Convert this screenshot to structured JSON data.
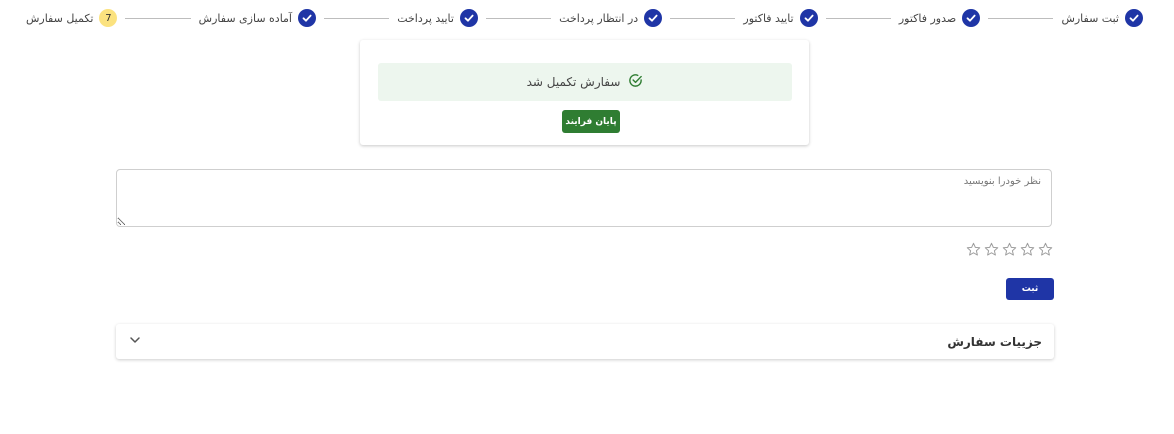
{
  "stepper": {
    "steps": [
      {
        "label": "ثبت سفارش",
        "status": "done",
        "icon": "check-icon"
      },
      {
        "label": "صدور فاکتور",
        "status": "done",
        "icon": "check-icon"
      },
      {
        "label": "تایید فاکتور",
        "status": "done",
        "icon": "check-icon"
      },
      {
        "label": "در انتظار پرداخت",
        "status": "done",
        "icon": "check-icon"
      },
      {
        "label": "تایید پرداخت",
        "status": "done",
        "icon": "check-icon"
      },
      {
        "label": "آماده سازی سفارش",
        "status": "done",
        "icon": "check-icon"
      },
      {
        "label": "تکمیل سفارش",
        "status": "active",
        "number": "7"
      }
    ]
  },
  "result": {
    "message": "سفارش تکمیل شد",
    "finish_button": "پایان فرایند"
  },
  "review": {
    "placeholder": "نظر خودرا بنویسید",
    "value": "",
    "rating": 0,
    "max_rating": 5,
    "submit_label": "ثبت"
  },
  "order_details": {
    "title": "جزییات سفارش",
    "expanded": false
  },
  "colors": {
    "primary": "#1f35a6",
    "success": "#2f7d32",
    "success_bg": "#edf6ee",
    "active_step": "#fbe27f"
  }
}
